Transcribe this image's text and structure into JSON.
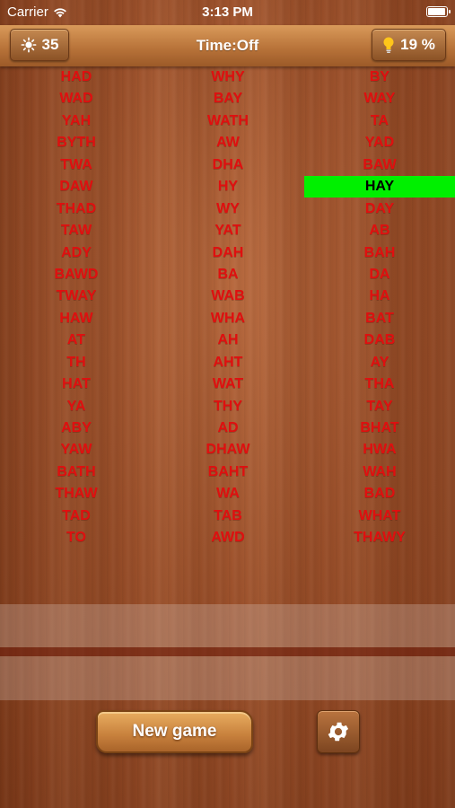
{
  "status_bar": {
    "carrier": "Carrier",
    "time": "3:13 PM",
    "battery_level": 1.0
  },
  "header": {
    "score": "35",
    "time_label": "Time:Off",
    "hint_percent": "19 %"
  },
  "colors": {
    "word": "#e00f0f",
    "selected_bg": "#00f000",
    "selected_text": "#000000"
  },
  "grid": {
    "rows": [
      [
        "HAD",
        "WHY",
        "BY"
      ],
      [
        "WAD",
        "BAY",
        "WAY"
      ],
      [
        "YAH",
        "WATH",
        "TA"
      ],
      [
        "BYTH",
        "AW",
        "YAD"
      ],
      [
        "TWA",
        "DHA",
        "BAW"
      ],
      [
        "DAW",
        "HY",
        "HAY"
      ],
      [
        "THAD",
        "WY",
        "DAY"
      ],
      [
        "TAW",
        "YAT",
        "AB"
      ],
      [
        "ADY",
        "DAH",
        "BAH"
      ],
      [
        "BAWD",
        "BA",
        "DA"
      ],
      [
        "TWAY",
        "WAB",
        "HA"
      ],
      [
        "HAW",
        "WHA",
        "BAT"
      ],
      [
        "AT",
        "AH",
        "DAB"
      ],
      [
        "TH",
        "AHT",
        "AY"
      ],
      [
        "HAT",
        "WAT",
        "THA"
      ],
      [
        "YA",
        "THY",
        "TAY"
      ],
      [
        "ABY",
        "AD",
        "BHAT"
      ],
      [
        "YAW",
        "DHAW",
        "HWA"
      ],
      [
        "BATH",
        "BAHT",
        "WAH"
      ],
      [
        "THAW",
        "WA",
        "BAD"
      ],
      [
        "TAD",
        "TAB",
        "WHAT"
      ],
      [
        "TO",
        "AWD",
        "THAWY"
      ]
    ],
    "selected": {
      "row": 5,
      "col": 2
    }
  },
  "footer": {
    "new_game_label": "New game"
  },
  "icons": {
    "score": "sun-icon",
    "hint": "lightbulb-icon",
    "settings": "gear-icon",
    "wifi": "wifi-icon"
  }
}
